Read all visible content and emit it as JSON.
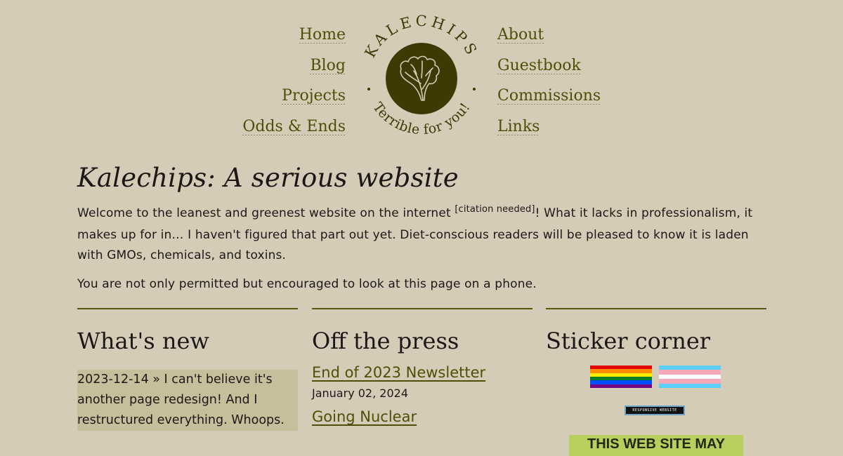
{
  "nav": {
    "left": [
      "Home",
      "Blog",
      "Projects",
      "Odds & Ends"
    ],
    "right": [
      "About",
      "Guestbook",
      "Commissions",
      "Links"
    ]
  },
  "logo": {
    "top_text": "KALECHIPS",
    "bottom_text": "Terrible for you!",
    "icon": "kale-leaf-icon"
  },
  "intro": {
    "title": "Kalechips: A serious website",
    "p1_before": "Welcome to the leanest and greenest website on the internet ",
    "citation": "[citation needed]",
    "p1_after": "! What it lacks in professionalism, it makes up for in… I haven't figured that part out yet. Diet-conscious readers will be pleased to know it is laden with GMOs, chemicals, and toxins.",
    "p2": "You are not only permitted but encouraged to look at this page on a phone."
  },
  "whats_new": {
    "heading": "What's new",
    "items": [
      "2023-12-14 » I can't believe it's another page redesign! And I restructured everything. Whoops."
    ]
  },
  "press": {
    "heading": "Off the press",
    "posts": [
      {
        "title": "End of 2023 Newsletter",
        "date": "January 02, 2024"
      },
      {
        "title": "Going Nuclear"
      }
    ]
  },
  "stickers": {
    "heading": "Sticker corner",
    "responsive_badge": "RESPONSIVE WEBSITE",
    "may_badge": "THIS WEB SITE MAY"
  },
  "colors": {
    "background": "#d5ccb7",
    "accent": "#4e4f07",
    "logo_fill": "#3d3a05",
    "highlight": "#c7be9c",
    "text": "#1e1716"
  }
}
